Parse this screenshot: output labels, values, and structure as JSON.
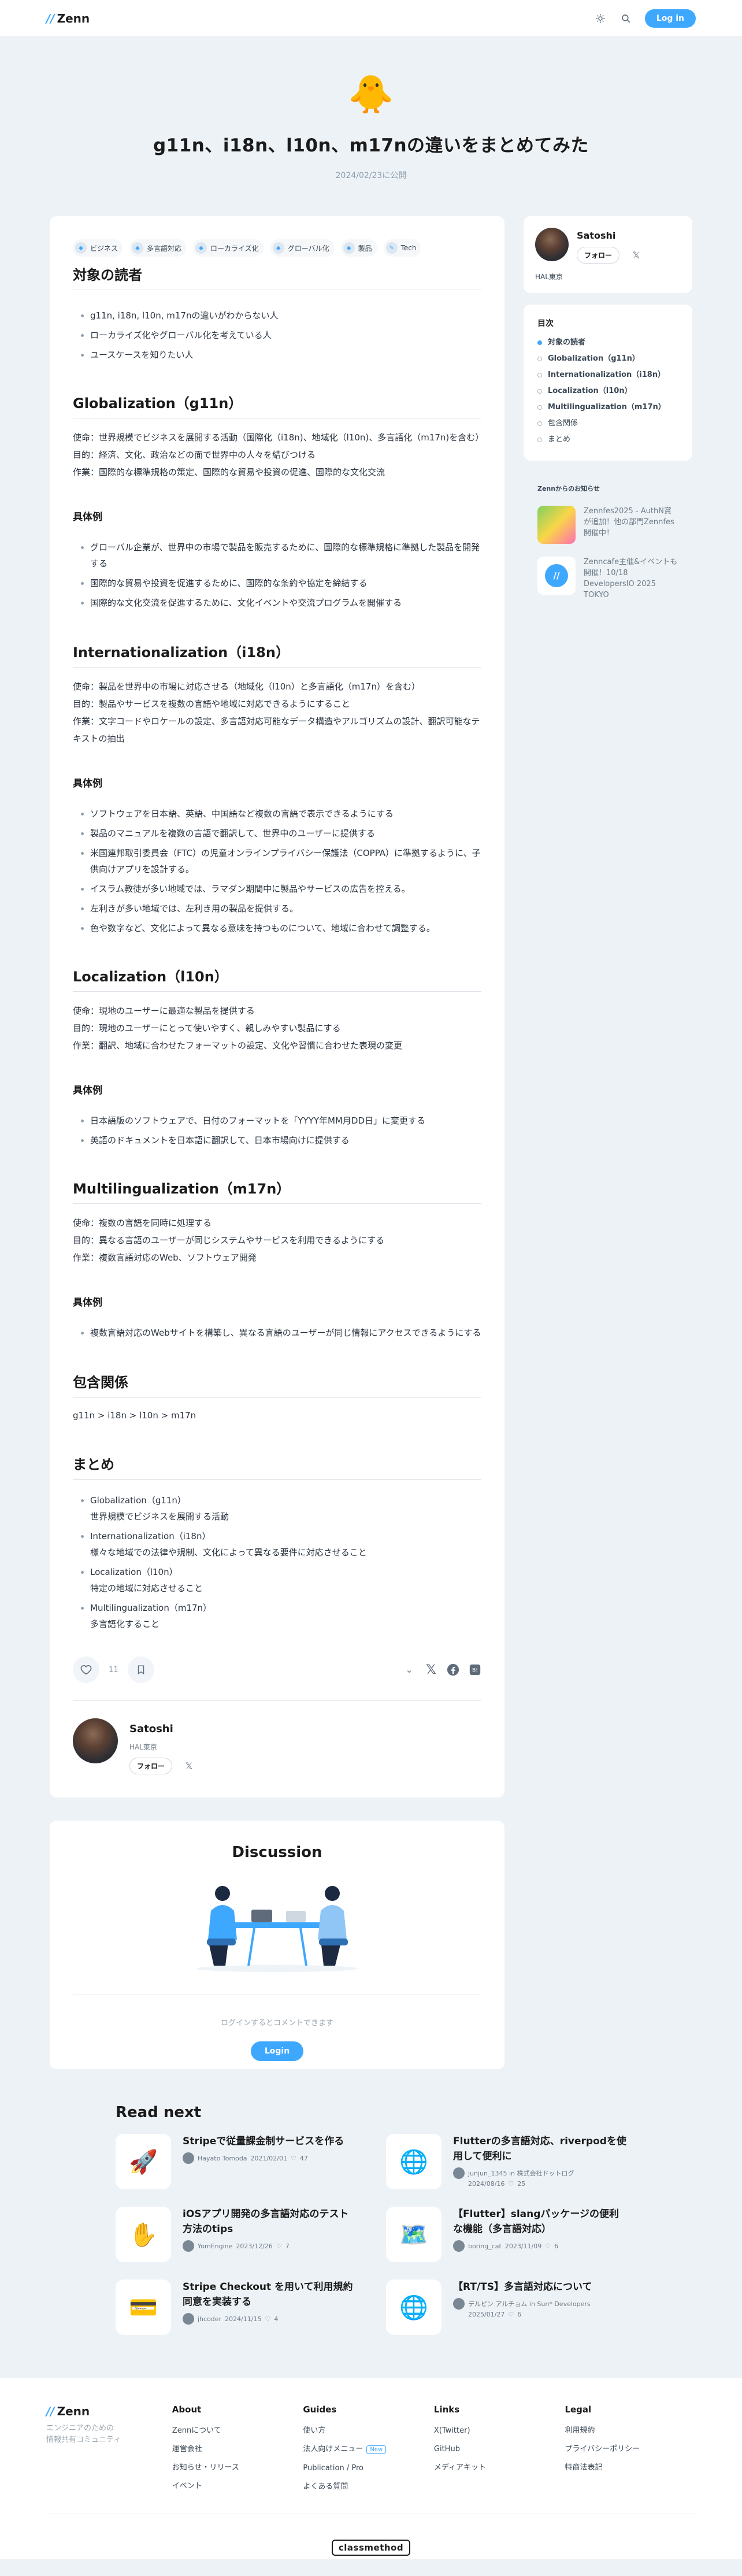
{
  "header": {
    "brand": "Zenn",
    "login_label": "Log in"
  },
  "article": {
    "emoji": "🐥",
    "title": "g11n、i18n、l10n、m17nの違いをまとめてみた",
    "date": "2024/02/23に公開",
    "topics": [
      "ビジネス",
      "多言語対応",
      "ローカライズ化",
      "グローバル化",
      "製品",
      "Tech"
    ],
    "sections": {
      "readers": {
        "heading": "対象の読者",
        "items": [
          "g11n, i18n, l10n, m17nの違いがわからない人",
          "ローカライズ化やグローバル化を考えている人",
          "ユースケースを知りたい人"
        ]
      },
      "g11n": {
        "heading": "Globalization（g11n）",
        "lines": [
          "使命：世界規模でビジネスを展開する活動（国際化（i18n)、地域化（l10n)、多言語化（m17n)を含む）",
          "目的：経済、文化、政治などの面で世界中の人々を結びつける",
          "作業：国際的な標準規格の策定、国際的な貿易や投資の促進、国際的な文化交流"
        ],
        "example_heading": "具体例",
        "examples": [
          "グローバル企業が、世界中の市場で製品を販売するために、国際的な標準規格に準拠した製品を開発する",
          "国際的な貿易や投資を促進するために、国際的な条約や協定を締結する",
          "国際的な文化交流を促進するために、文化イベントや交流プログラムを開催する"
        ]
      },
      "i18n": {
        "heading": "Internationalization（i18n）",
        "lines": [
          "使命：製品を世界中の市場に対応させる（地域化（l10n）と多言語化（m17n）を含む）",
          "目的：製品やサービスを複数の言語や地域に対応できるようにすること",
          "作業：文字コードやロケールの設定、多言語対応可能なデータ構造やアルゴリズムの設計、翻訳可能なテキストの抽出"
        ],
        "example_heading": "具体例",
        "examples": [
          "ソフトウェアを日本語、英語、中国語など複数の言語で表示できるようにする",
          "製品のマニュアルを複数の言語で翻訳して、世界中のユーザーに提供する",
          "米国連邦取引委員会（FTC）の児童オンラインプライバシー保護法（COPPA）に準拠するように、子供向けアプリを設計する。",
          "イスラム教徒が多い地域では、ラマダン期間中に製品やサービスの広告を控える。",
          "左利きが多い地域では、左利き用の製品を提供する。",
          "色や数字など、文化によって異なる意味を持つものについて、地域に合わせて調整する。"
        ]
      },
      "l10n": {
        "heading": "Localization（l10n）",
        "lines": [
          "使命：現地のユーザーに最適な製品を提供する",
          "目的：現地のユーザーにとって使いやすく、親しみやすい製品にする",
          "作業：翻訳、地域に合わせたフォーマットの設定、文化や習慣に合わせた表現の変更"
        ],
        "example_heading": "具体例",
        "examples": [
          "日本語版のソフトウェアで、日付のフォーマットを「YYYY年MM月DD日」に変更する",
          "英語のドキュメントを日本語に翻訳して、日本市場向けに提供する"
        ]
      },
      "m17n": {
        "heading": "Multilingualization（m17n）",
        "lines": [
          "使命：複数の言語を同時に処理する",
          "目的：異なる言語のユーザーが同じシステムやサービスを利用できるようにする",
          "作業：複数言語対応のWeb、ソフトウェア開発"
        ],
        "example_heading": "具体例",
        "examples": [
          "複数言語対応のWebサイトを構築し、異なる言語のユーザーが同じ情報にアクセスできるようにする"
        ]
      },
      "inclusion": {
        "heading": "包含関係",
        "text": "g11n > i18n > l10n > m17n"
      },
      "summary": {
        "heading": "まとめ",
        "items": [
          {
            "title": "Globalization（g11n）",
            "desc": "世界規模でビジネスを展開する活動"
          },
          {
            "title": "Internationalization（i18n）",
            "desc": "様々な地域での法律や規制、文化によって異なる要件に対応させること"
          },
          {
            "title": "Localization（l10n）",
            "desc": "特定の地域に対応させること"
          },
          {
            "title": "Multilingualization（m17n）",
            "desc": "多言語化すること"
          }
        ]
      }
    },
    "likes": "11"
  },
  "author": {
    "name": "Satoshi",
    "location": "HAL東京",
    "follow_label": "フォロー"
  },
  "toc": {
    "heading": "目次",
    "items": [
      "対象の読者",
      "Globalization（g11n）",
      "Internationalization（i18n）",
      "Localization（l10n）",
      "Multilingualization（m17n）",
      "包含関係",
      "まとめ"
    ]
  },
  "news": {
    "heading": "Zennからのお知らせ",
    "items": [
      {
        "text": "Zennfes2025 - AuthN賞が追加！他の部門Zennfes開催中！",
        "color": "#7fd15e"
      },
      {
        "text": "Zenncafe主催&イベントも開催！10/18 DevelopersIO 2025 TOKYO",
        "color": "#3ea8ff"
      }
    ]
  },
  "discussion": {
    "heading": "Discussion",
    "note": "ログインするとコメントできます",
    "login_label": "Login"
  },
  "read_next": {
    "heading": "Read next",
    "items": [
      {
        "emoji": "🚀",
        "title": "Stripeで従量課金制サービスを作る",
        "author": "Hayato Tomoda",
        "date": "2021/02/01",
        "likes": "47"
      },
      {
        "emoji": "🌐",
        "title": "Flutterの多言語対応、riverpodを使用して便利に",
        "author": "junjun_1345 in 株式会社ドットログ",
        "date": "2024/08/16",
        "likes": "25"
      },
      {
        "emoji": "✋",
        "title": "iOSアプリ開発の多言語対応のテスト方法のtips",
        "author": "YomEngine",
        "date": "2023/12/26",
        "likes": "7"
      },
      {
        "emoji": "🗺️",
        "title": "【Flutter】slangパッケージの便利な機能（多言語対応）",
        "author": "boring_cat",
        "date": "2023/11/09",
        "likes": "6"
      },
      {
        "emoji": "💳",
        "title": "Stripe Checkout を用いて利用規約同意を実装する",
        "author": "jhcoder",
        "date": "2024/11/15",
        "likes": "4"
      },
      {
        "emoji": "🌐",
        "title": "【RT/TS】多言語対応について",
        "author": "デルピン アルチョム in Sun* Developers",
        "date": "2025/01/27",
        "likes": "6"
      }
    ]
  },
  "footer": {
    "brand": "Zenn",
    "tagline": "エンジニアのための\n情報共有コミュニティ",
    "cols": [
      {
        "heading": "About",
        "links": [
          "Zennについて",
          "運営会社",
          "お知らせ・リリース",
          "イベント"
        ]
      },
      {
        "heading": "Guides",
        "links": [
          "使い方",
          "法人向けメニュー",
          "Publication / Pro",
          "よくある質問"
        ],
        "badge": "New"
      },
      {
        "heading": "Links",
        "links": [
          "X(Twitter)",
          "GitHub",
          "メディアキット"
        ]
      },
      {
        "heading": "Legal",
        "links": [
          "利用規約",
          "プライバシーポリシー",
          "特商法表記"
        ]
      }
    ],
    "company": "classmethod"
  }
}
